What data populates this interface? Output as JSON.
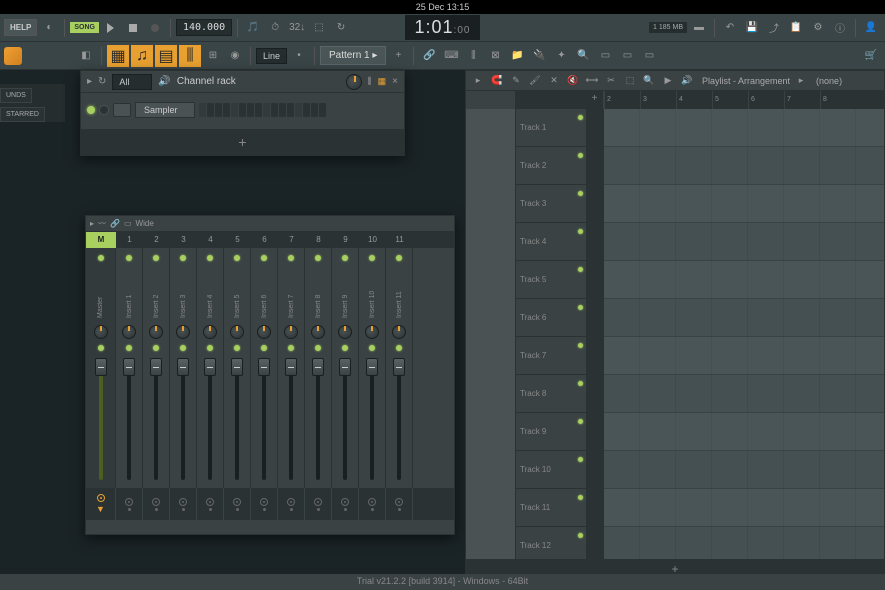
{
  "os": {
    "datetime": "25 Dec  13:15"
  },
  "toolbar": {
    "help": "HELP",
    "song": "SONG",
    "tempo": "140.000",
    "time": "1:01",
    "time_sub": ":00",
    "cpu": "185 MB",
    "cpu_pct": "1"
  },
  "toolbar2": {
    "snap": "Line",
    "pattern": "Pattern 1"
  },
  "sidebar": {
    "tab1": "UNDS",
    "tab2": "STARRED"
  },
  "channel_rack": {
    "title": "Channel rack",
    "filter": "All",
    "channel_name": "Sampler",
    "add": "+"
  },
  "mixer": {
    "view": "Wide",
    "master": "M",
    "master_label": "Master",
    "inserts": [
      {
        "num": "1",
        "label": "Insert 1"
      },
      {
        "num": "2",
        "label": "Insert 2"
      },
      {
        "num": "3",
        "label": "Insert 3"
      },
      {
        "num": "4",
        "label": "Insert 4"
      },
      {
        "num": "5",
        "label": "Insert 5"
      },
      {
        "num": "6",
        "label": "Insert 6"
      },
      {
        "num": "7",
        "label": "Insert 7"
      },
      {
        "num": "8",
        "label": "Insert 8"
      },
      {
        "num": "9",
        "label": "Insert 9"
      },
      {
        "num": "10",
        "label": "Insert 10"
      },
      {
        "num": "11",
        "label": "Insert 11"
      }
    ]
  },
  "playlist": {
    "title": "Playlist - Arrangement",
    "subtitle": "(none)",
    "add": "+",
    "timeline": [
      "2",
      "3",
      "4",
      "5",
      "6",
      "7",
      "8"
    ],
    "tracks": [
      "Track 1",
      "Track 2",
      "Track 3",
      "Track 4",
      "Track 5",
      "Track 6",
      "Track 7",
      "Track 8",
      "Track 9",
      "Track 10",
      "Track 11",
      "Track 12"
    ],
    "footer_add": "+"
  },
  "status": "Trial v21.2.2 [build 3914] - Windows - 64Bit"
}
